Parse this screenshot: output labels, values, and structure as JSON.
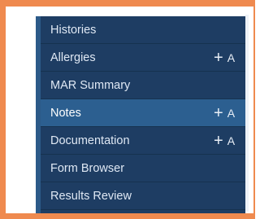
{
  "menu": {
    "items": [
      {
        "label": "Histories",
        "add_label": "",
        "active": false
      },
      {
        "label": "Allergies",
        "add_label": "A",
        "active": false
      },
      {
        "label": "MAR Summary",
        "add_label": "",
        "active": false
      },
      {
        "label": "Notes",
        "add_label": "A",
        "active": false
      },
      {
        "label": "Documentation",
        "add_label": "A",
        "active": false
      },
      {
        "label": "Form Browser",
        "add_label": "",
        "active": false
      },
      {
        "label": "Results Review",
        "add_label": "",
        "active": false
      }
    ],
    "add_icon": "plus-icon"
  },
  "colors": {
    "highlight_border": "#ef8a4f",
    "menu_background": "#1e3d63",
    "active_row": "#2c5f90"
  }
}
